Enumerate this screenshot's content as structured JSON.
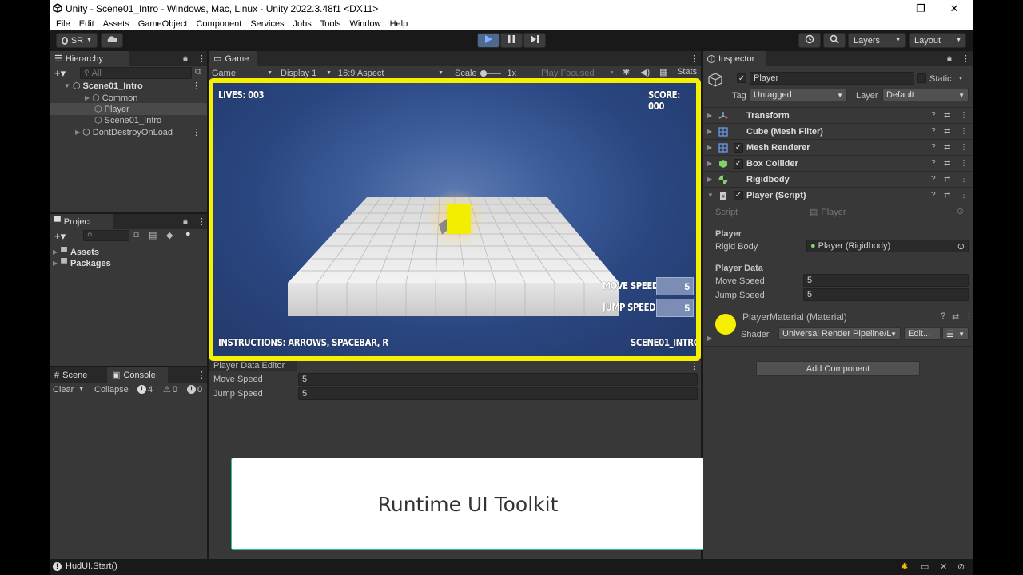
{
  "window": {
    "title": "Unity - Scene01_Intro - Windows, Mac, Linux - Unity 2022.3.48f1 <DX11>",
    "controls": [
      "—",
      "❐",
      "✕"
    ]
  },
  "menu": [
    "File",
    "Edit",
    "Assets",
    "GameObject",
    "Component",
    "Services",
    "Jobs",
    "Tools",
    "Window",
    "Help"
  ],
  "toolbar": {
    "account": "SR",
    "layers": "Layers",
    "layout": "Layout"
  },
  "hierarchy": {
    "tab": "Hierarchy",
    "search_placeholder": "All",
    "scene": "Scene01_Intro",
    "items": [
      "Common",
      "Player",
      "Scene01_Intro"
    ],
    "dontdestroy": "DontDestroyOnLoad"
  },
  "project": {
    "tab": "Project",
    "items": [
      "Assets",
      "Packages"
    ]
  },
  "console": {
    "tab_scene": "Scene",
    "tab_console": "Console",
    "clear": "Clear",
    "collapse": "Collapse",
    "count_errors": "4",
    "count_warnings": "0",
    "count_messages": "0"
  },
  "game": {
    "tab": "Game",
    "mode": "Game",
    "display": "Display 1",
    "aspect": "16:9 Aspect",
    "scale_label": "Scale",
    "scale_value": "1x",
    "play_focused": "Play Focused",
    "stats": "Stats",
    "hud": {
      "lives": "LIVES: 003",
      "score": "SCORE: 000",
      "move_speed_label": "MOVE SPEED",
      "move_speed_value": "5",
      "jump_speed_label": "JUMP SPEED",
      "jump_speed_value": "5",
      "instructions": "INSTRUCTIONS: ARROWS, SPACEBAR, R",
      "scene_name": "SCENE01_INTRO"
    },
    "colors": {
      "highlight": "#f5f000",
      "sky": "#2e4a7e"
    }
  },
  "player_data_editor": {
    "title": "Player Data Editor",
    "move_speed_label": "Move Speed",
    "move_speed_value": "5",
    "jump_speed_label": "Jump Speed",
    "jump_speed_value": "5"
  },
  "caption": "Runtime UI Toolkit",
  "inspector": {
    "tab": "Inspector",
    "object_name": "Player",
    "static": "Static",
    "tag_label": "Tag",
    "tag_value": "Untagged",
    "layer_label": "Layer",
    "layer_value": "Default",
    "components": [
      "Transform",
      "Cube (Mesh Filter)",
      "Mesh Renderer",
      "Box Collider",
      "Rigidbody",
      "Player (Script)"
    ],
    "script_label": "Script",
    "script_value": "Player",
    "section_player": "Player",
    "rigidbody_label": "Rigid Body",
    "rigidbody_value": "Player (Rigidbody)",
    "section_player_data": "Player Data",
    "move_speed_label": "Move Speed",
    "move_speed_value": "5",
    "jump_speed_label": "Jump Speed",
    "jump_speed_value": "5",
    "material_name": "PlayerMaterial (Material)",
    "shader_label": "Shader",
    "shader_value": "Universal Render Pipeline/L",
    "edit_button": "Edit...",
    "add_component": "Add Component"
  },
  "status": {
    "message": "HudUI.Start()"
  }
}
